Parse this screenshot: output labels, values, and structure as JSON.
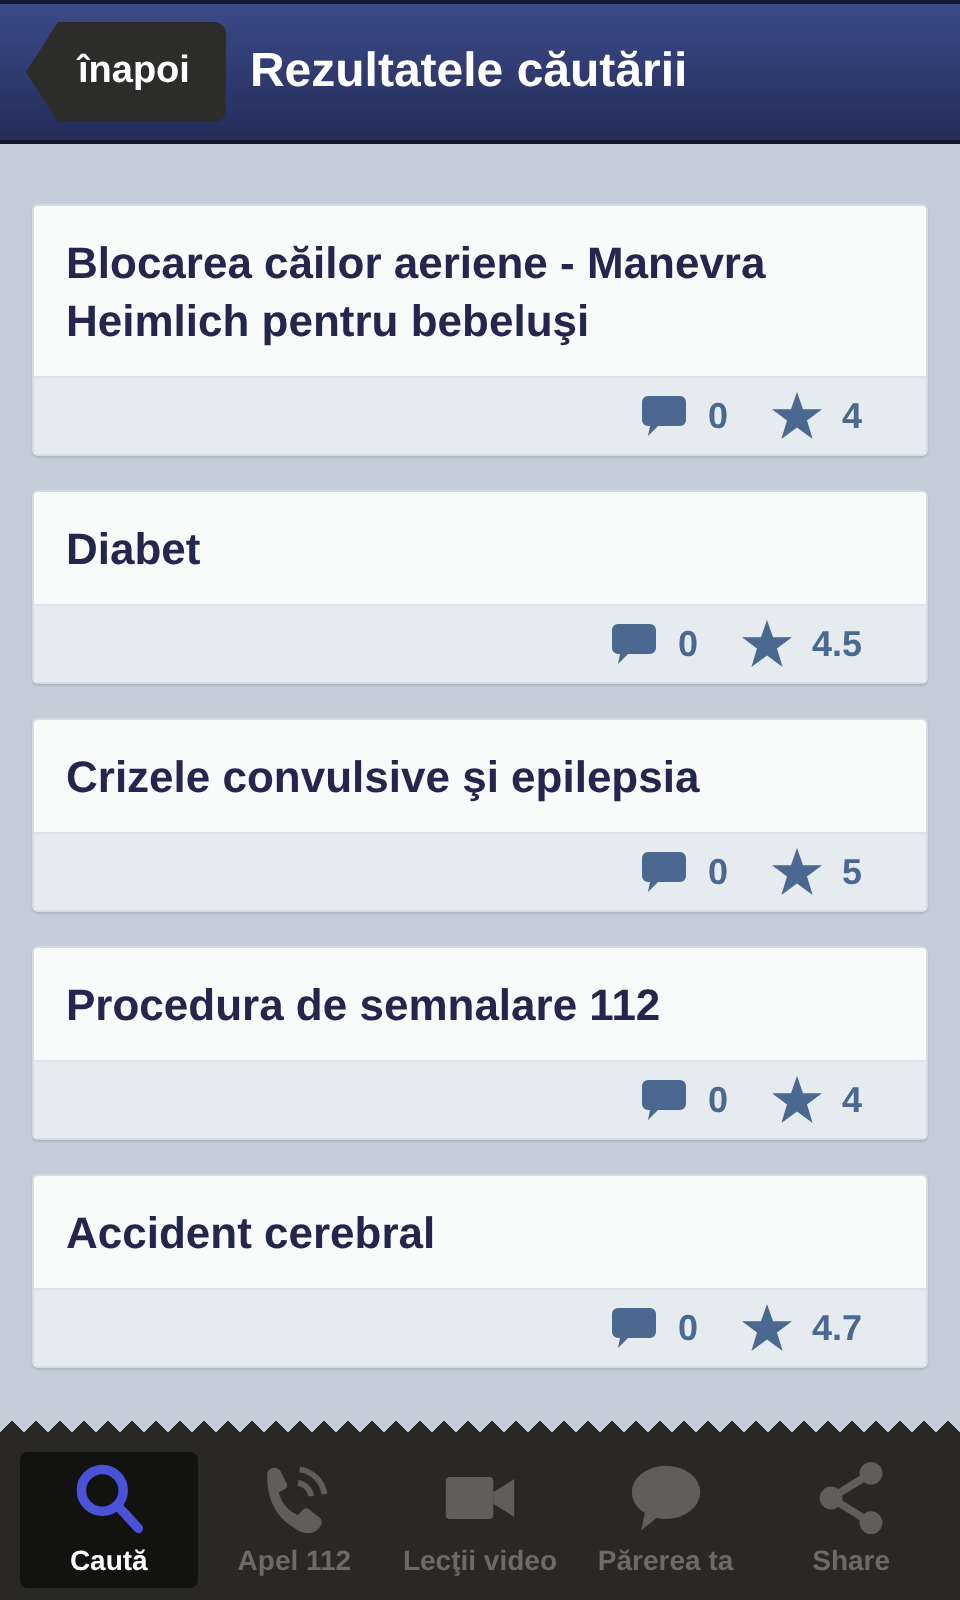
{
  "header": {
    "back_label": "înapoi",
    "title": "Rezultatele căutării"
  },
  "results": [
    {
      "title": "Blocarea căilor aeriene - Manevra Heimlich pentru bebeluşi",
      "comments": "0",
      "rating": "4"
    },
    {
      "title": "Diabet",
      "comments": "0",
      "rating": "4.5"
    },
    {
      "title": "Crizele convulsive şi epilepsia",
      "comments": "0",
      "rating": "5"
    },
    {
      "title": "Procedura de semnalare 112",
      "comments": "0",
      "rating": "4"
    },
    {
      "title": "Accident cerebral",
      "comments": "0",
      "rating": "4.7"
    }
  ],
  "tabs": [
    {
      "kind": "search",
      "label": "Caută",
      "selected": true
    },
    {
      "kind": "phone",
      "label": "Apel 112",
      "selected": false
    },
    {
      "kind": "video",
      "label": "Lecţii video",
      "selected": false
    },
    {
      "kind": "chat",
      "label": "Părerea ta",
      "selected": false
    },
    {
      "kind": "share",
      "label": "Share",
      "selected": false
    }
  ]
}
